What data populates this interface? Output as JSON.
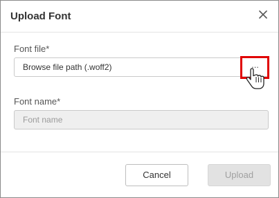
{
  "dialog": {
    "title": "Upload Font",
    "close_icon": "close-icon"
  },
  "font_file": {
    "label": "Font file*",
    "path_text": "Browse file path (.woff2)",
    "browse_label": "...",
    "browse_highlight_color": "#e00000"
  },
  "font_name": {
    "label": "Font name*",
    "placeholder": "Font name",
    "value": ""
  },
  "footer": {
    "cancel_label": "Cancel",
    "upload_label": "Upload",
    "upload_disabled": true
  },
  "pointer": {
    "icon": "hand-pointer-icon"
  }
}
